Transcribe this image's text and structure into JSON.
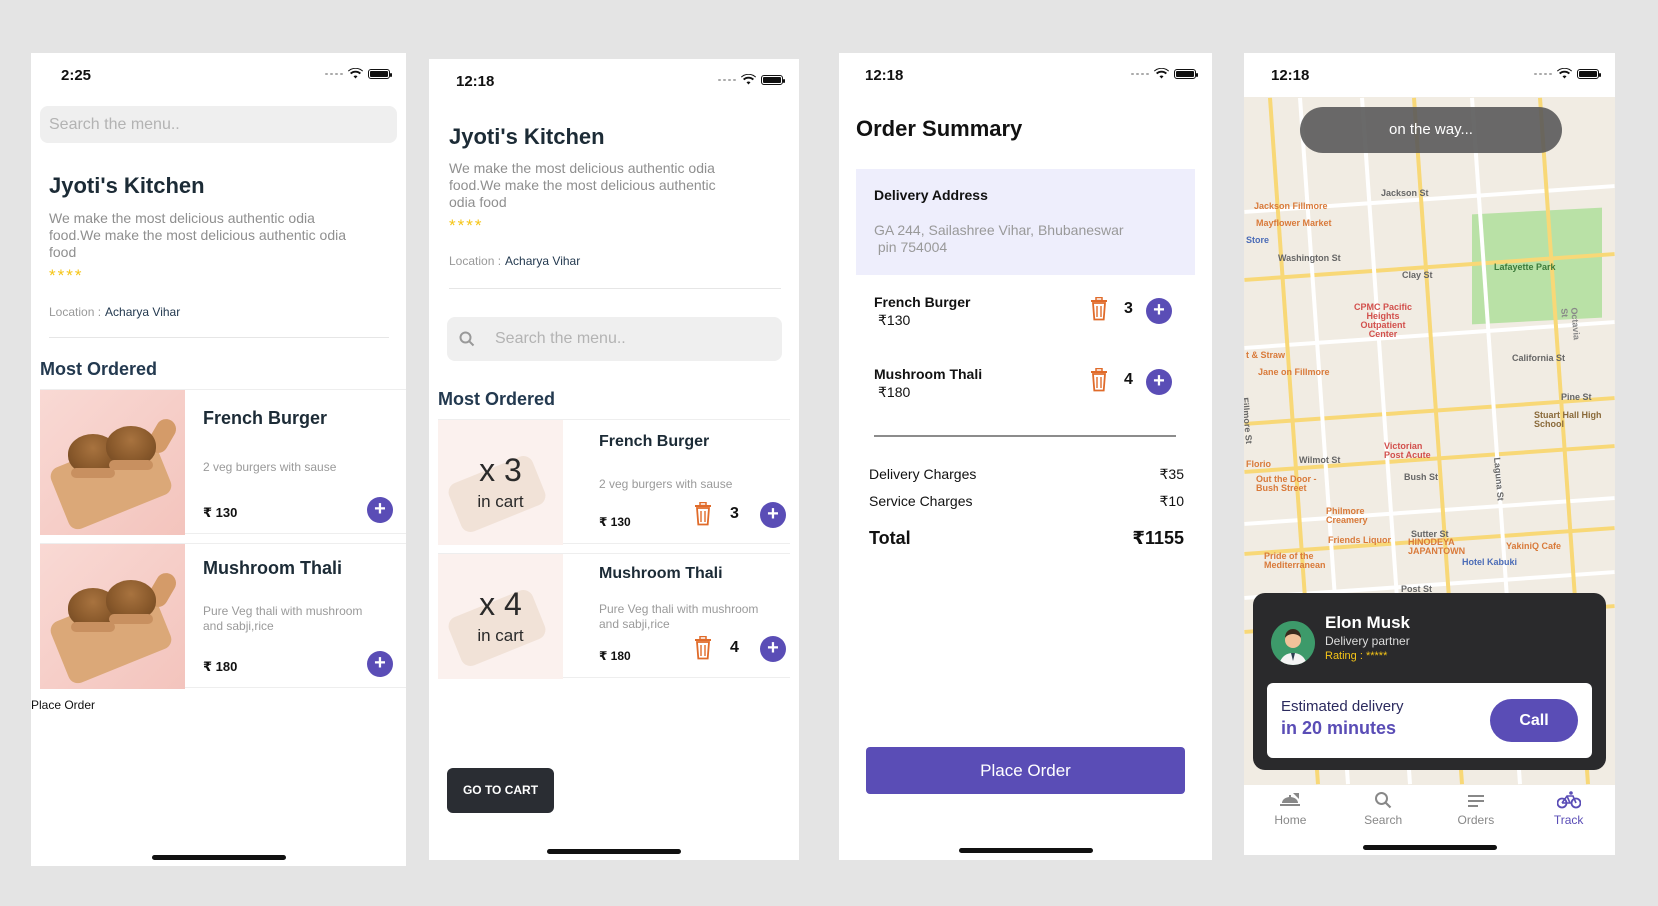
{
  "screen1": {
    "time": "2:25",
    "search_placeholder": "Search the menu..",
    "restaurant": "Jyoti's Kitchen",
    "description": "We make the most delicious authentic odia food.We make the most delicious authentic odia food",
    "stars": "****",
    "location_label": "Location :",
    "location_value": "Acharya Vihar",
    "section": "Most Ordered",
    "items": [
      {
        "name": "French Burger",
        "desc": "2 veg burgers with sause",
        "price": "₹ 130"
      },
      {
        "name": "Mushroom Thali",
        "desc": "Pure Veg thali with mushroom and sabji,rice",
        "price": "₹ 180"
      }
    ],
    "place_order": "Place Order"
  },
  "screen2": {
    "time": "12:18",
    "restaurant": "Jyoti's Kitchen",
    "description": "We make the most delicious authentic odia food.We make the most delicious authentic odia food",
    "stars": "****",
    "location_label": "Location :",
    "location_value": "Acharya Vihar",
    "search_placeholder": "Search the menu..",
    "section": "Most Ordered",
    "items": [
      {
        "count": "x 3",
        "in_cart": "in cart",
        "name": "French Burger",
        "desc": "2 veg burgers with sause",
        "price": "₹ 130",
        "qty": "3"
      },
      {
        "count": "x 4",
        "in_cart": "in cart",
        "name": "Mushroom Thali",
        "desc": "Pure Veg thali with mushroom and sabji,rice",
        "price": "₹ 180",
        "qty": "4"
      }
    ],
    "go_to_cart": "GO TO CART"
  },
  "screen3": {
    "time": "12:18",
    "title": "Order Summary",
    "address_title": "Delivery Address",
    "address_line1": "GA 244, Sailashree Vihar, Bhubaneswar",
    "address_line2": " pin 754004",
    "items": [
      {
        "name": "French Burger",
        "price": "₹130",
        "qty": "3"
      },
      {
        "name": "Mushroom Thali",
        "price": "₹180",
        "qty": "4"
      }
    ],
    "charges": [
      {
        "label": "Delivery Charges",
        "value": "₹35"
      },
      {
        "label": "Service Charges",
        "value": "₹10"
      }
    ],
    "total_label": "Total",
    "total_value": "₹1155",
    "place_order": "Place Order"
  },
  "screen4": {
    "time": "12:18",
    "status": "on the way...",
    "map_labels": {
      "jackson": "Jackson St",
      "washington": "Washington St",
      "clay": "Clay St",
      "california": "California St",
      "pine": "Pine St",
      "bush": "Bush St",
      "sutter": "Sutter St",
      "post": "Post St",
      "wilmot": "Wilmot St",
      "fillmore": "Fillmore St",
      "laguna": "Laguna St",
      "octavia": "Octavia St",
      "lafayette": "Lafayette Park",
      "cpmc": "CPMC Pacific Heights Outpatient Center",
      "jackson_fillmore": "Jackson Fillmore",
      "mayflower": "Mayflower Market",
      "jane": "Jane on Fillmore",
      "stuart": "Stuart Hall High School",
      "victorian": "Victorian Post Acute",
      "florio": "Florio",
      "out_the_door": "Out the Door - Bush Street",
      "philmore": "Philmore Creamery",
      "friends": "Friends Liquor",
      "hinodeya": "HINODEYA JAPANTOWN",
      "yakinq": "YakiniQ Cafe",
      "pride": "Pride of the Mediterranean",
      "kabuki": "Hotel Kabuki",
      "straw": "t & Straw",
      "store": "Store"
    },
    "driver_name": "Elon Musk",
    "driver_role": "Delivery partner",
    "driver_rating": "Rating : *****",
    "eta_label": "Estimated delivery",
    "eta_value": "in 20 minutes",
    "call": "Call",
    "tabs": [
      {
        "label": "Home",
        "icon": "home-icon"
      },
      {
        "label": "Search",
        "icon": "search-icon"
      },
      {
        "label": "Orders",
        "icon": "orders-icon"
      },
      {
        "label": "Track",
        "icon": "bicycle-icon"
      }
    ],
    "active_tab": "Track"
  },
  "colors": {
    "accent": "#5a4db6",
    "trash": "#e06b2a",
    "star": "#f5c518",
    "background": "#e4e4e4"
  }
}
